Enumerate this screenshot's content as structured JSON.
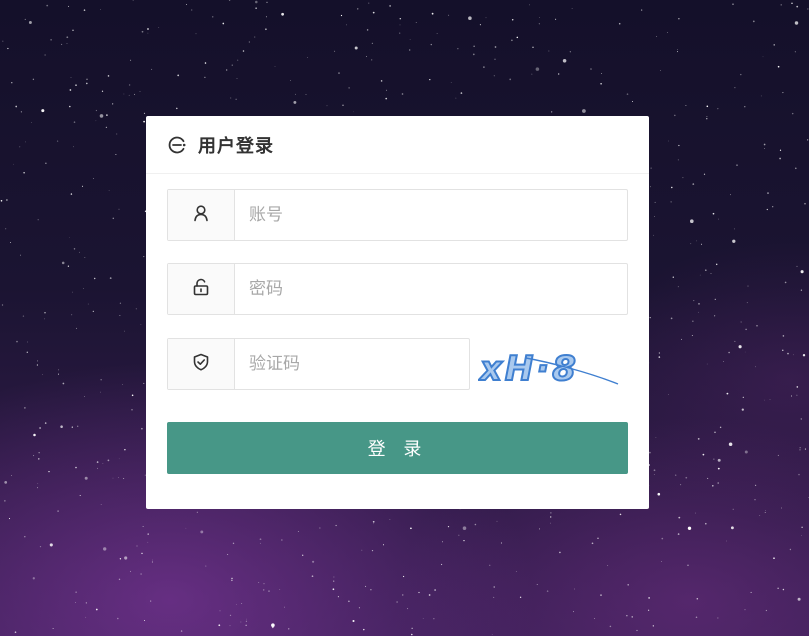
{
  "login": {
    "title": "用户登录",
    "account_placeholder": "账号",
    "password_placeholder": "密码",
    "captcha_placeholder": "验证码",
    "captcha_text": "xH·8",
    "submit_label": "登 录"
  },
  "icons": {
    "header": "login-logo-icon",
    "account": "user-icon",
    "password": "lock-icon",
    "captcha": "shield-check-icon"
  },
  "colors": {
    "primary": "#479787",
    "card": "#ffffff",
    "background": "#1b1432"
  }
}
